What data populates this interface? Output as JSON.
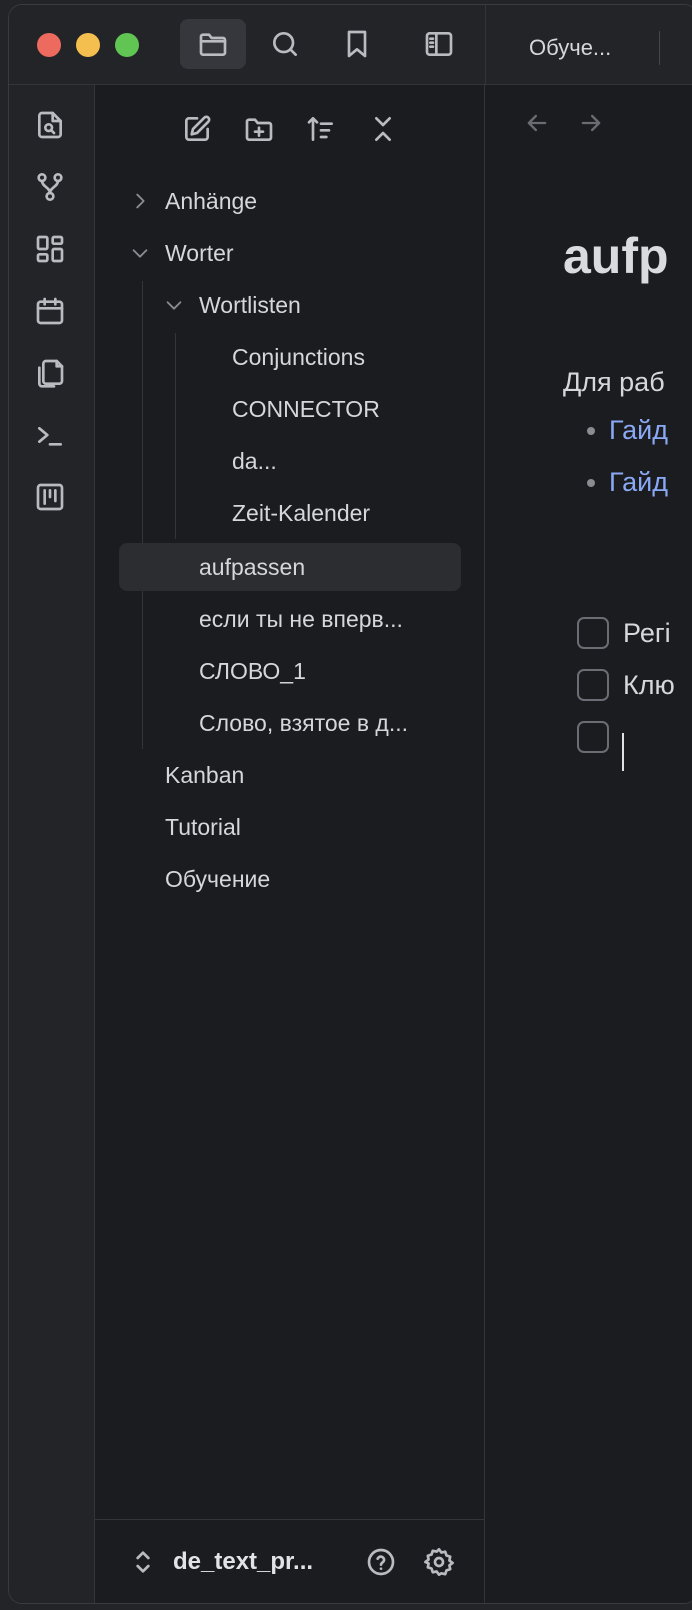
{
  "titlebar": {
    "tab_title": "Обуче...",
    "buttons": [
      "folder-icon",
      "search-icon",
      "bookmark-icon",
      "sidebar-toggle-icon"
    ]
  },
  "ribbon": {
    "icons": [
      "quick-switcher-icon",
      "graph-view-icon",
      "canvas-icon",
      "daily-note-icon",
      "templates-icon",
      "command-palette-icon",
      "kanban-icon"
    ]
  },
  "sidebar": {
    "toolbar": [
      "new-note-icon",
      "new-folder-icon",
      "sort-icon",
      "collapse-all-icon"
    ],
    "tree": {
      "anhaenge": "Anhänge",
      "worter": "Worter",
      "wortlisten": "Wortlisten",
      "conjunctions": "Conjunctions",
      "connector": "CONNECTOR",
      "da": "da...",
      "zeit_kalender": "Zeit-Kalender",
      "aufpassen": "aufpassen",
      "esli": "если ты не вперв...",
      "slovo1": "СЛОВО_1",
      "slovo_vzyatoe": "Слово, взятое в д...",
      "kanban": "Kanban",
      "tutorial": "Tutorial",
      "obuchenie": "Обучение"
    },
    "footer": {
      "vault_name": "de_text_pr..."
    }
  },
  "editor": {
    "title": "aufp",
    "paragraph": "Для раб",
    "links": [
      "Гайд",
      "Гайд"
    ],
    "tasks": [
      "Регі",
      "Клю",
      ""
    ]
  },
  "colors": {
    "background": "#1b1c1f",
    "panel": "#232428",
    "link": "#8aa9f5",
    "selected": "#2c2d31"
  }
}
